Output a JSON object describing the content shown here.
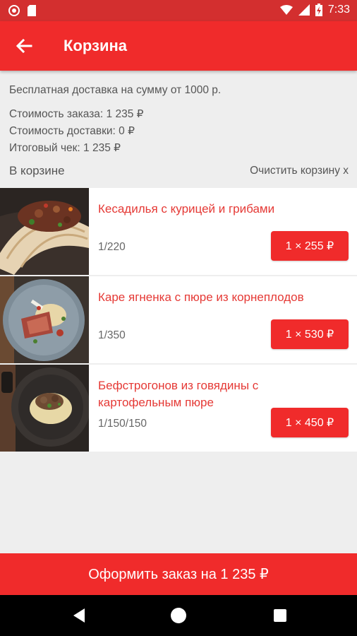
{
  "status_bar": {
    "time": "7:33"
  },
  "appbar": {
    "title": "Корзина",
    "back_icon": "arrow-back-icon"
  },
  "info": {
    "free_delivery": "Бесплатная доставка на сумму от 1000 р.",
    "order_cost": "Стоимость заказа: 1 235 ₽",
    "delivery_cost": "Стоимость доставки: 0 ₽",
    "total": "Итоговый чек: 1 235 ₽"
  },
  "cart": {
    "title": "В корзине",
    "clear_label": "Очистить корзину x",
    "items": [
      {
        "name": "Кесадилья с курицей и грибами",
        "weight": "1/220",
        "price": "1 × 255 ₽"
      },
      {
        "name": "Каре ягненка с пюре из корнеплодов",
        "weight": "1/350",
        "price": "1 × 530 ₽"
      },
      {
        "name": "Бефстрогонов из говядины с картофельным пюре",
        "weight": "1/150/150",
        "price": "1 × 450 ₽"
      }
    ]
  },
  "checkout": {
    "label": "Оформить заказ на 1 235 ₽"
  },
  "colors": {
    "accent": "#f02b2b",
    "status_bar": "#d32f2f",
    "item_title": "#e53935",
    "background": "#eeeeee"
  }
}
